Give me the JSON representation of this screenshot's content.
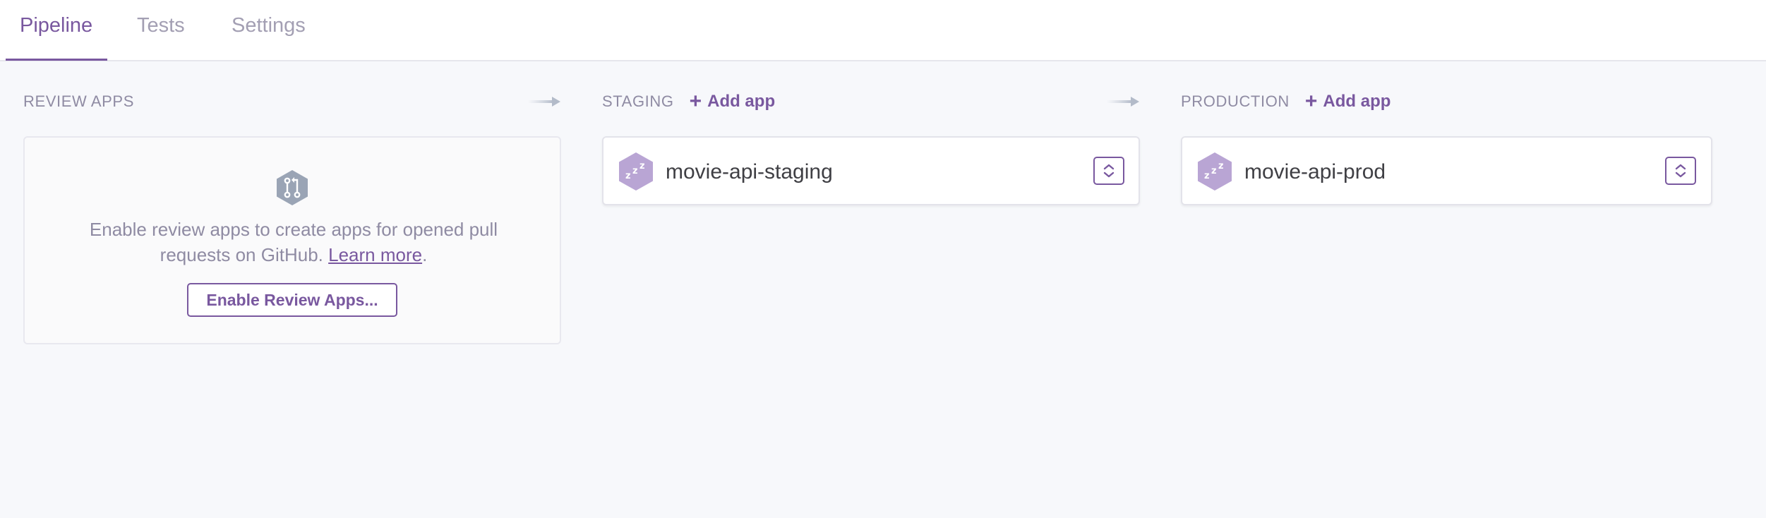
{
  "tabs": [
    {
      "label": "Pipeline",
      "active": true
    },
    {
      "label": "Tests",
      "active": false
    },
    {
      "label": "Settings",
      "active": false
    }
  ],
  "columns": {
    "review": {
      "title": "REVIEW APPS",
      "description": "Enable review apps to create apps for opened pull requests on GitHub.",
      "learn_more": "Learn more",
      "suffix": ".",
      "button_label": "Enable Review Apps...",
      "icon": "pull-request-icon"
    },
    "staging": {
      "title": "STAGING",
      "add_label": "Add app",
      "app": {
        "name": "movie-api-staging",
        "icon": "sleeping-dyno-icon"
      }
    },
    "production": {
      "title": "PRODUCTION",
      "add_label": "Add app",
      "app": {
        "name": "movie-api-prod",
        "icon": "sleeping-dyno-icon"
      }
    }
  },
  "colors": {
    "accent": "#79589f",
    "muted_text": "#8f8ba3",
    "background": "#f7f8fb",
    "hex_app": "#b9a5d4",
    "hex_review": "#9aa4b5"
  }
}
